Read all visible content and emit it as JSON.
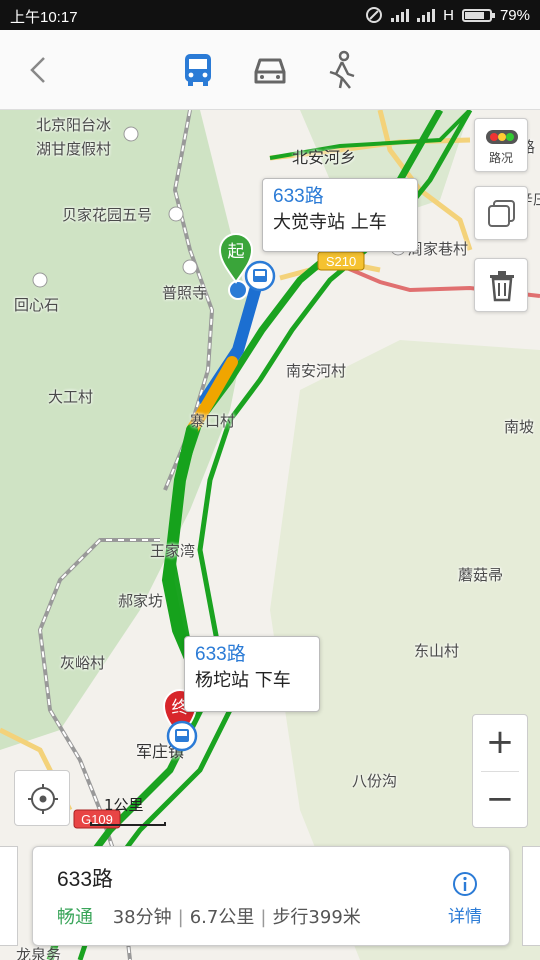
{
  "status_bar": {
    "time": "上午10:17",
    "network": "H",
    "battery": "79%",
    "battery_level": 0.79
  },
  "nav": {
    "active_mode": "bus",
    "modes": [
      "bus",
      "car",
      "walk"
    ]
  },
  "map": {
    "places": [
      {
        "key": "p1",
        "text": "北京阳台冰"
      },
      {
        "key": "p2",
        "text": "湖甘度假村"
      },
      {
        "key": "p3",
        "text": "北安河乡"
      },
      {
        "key": "p4",
        "text": "北清路"
      },
      {
        "key": "p5",
        "text": "贝家花园五号"
      },
      {
        "key": "p6",
        "text": "辛庄"
      },
      {
        "key": "p7",
        "text": "周家巷村"
      },
      {
        "key": "p8",
        "text": "普照寺"
      },
      {
        "key": "p9",
        "text": "回心石"
      },
      {
        "key": "p10",
        "text": "南安河村"
      },
      {
        "key": "p11",
        "text": "大工村"
      },
      {
        "key": "p12",
        "text": "寨口村"
      },
      {
        "key": "p13",
        "text": "南坡"
      },
      {
        "key": "p14",
        "text": "王家湾"
      },
      {
        "key": "p15",
        "text": "蘑菇帚"
      },
      {
        "key": "p16",
        "text": "郝家坊"
      },
      {
        "key": "p17",
        "text": "东山村"
      },
      {
        "key": "p18",
        "text": "灰峪村"
      },
      {
        "key": "p19",
        "text": "军庄镇"
      },
      {
        "key": "p20",
        "text": "八份沟"
      },
      {
        "key": "p21",
        "text": "龙泉务"
      }
    ],
    "road_labels": {
      "s210": "S210",
      "g109": "G109"
    },
    "start_marker": "起",
    "end_marker": "终",
    "boarding": {
      "route": "633路",
      "stop": "大觉寺站  上车"
    },
    "alighting": {
      "route": "633路",
      "stop": "杨坨站  下车"
    },
    "side_buttons": {
      "traffic_label": "路况"
    },
    "zoom": {
      "in": "+",
      "out": "−"
    },
    "scale": "1公里"
  },
  "route_card": {
    "title": "633路",
    "traffic": "畅通",
    "duration": "38分钟",
    "distance": "6.7公里",
    "walk": "步行399米",
    "details_label": "详情"
  },
  "colors": {
    "accent": "#2b7bd6",
    "traffic_green": "#1aa320",
    "traffic_yellow": "#f0a500",
    "start_green": "#3aa53a",
    "end_red": "#d8262b"
  }
}
